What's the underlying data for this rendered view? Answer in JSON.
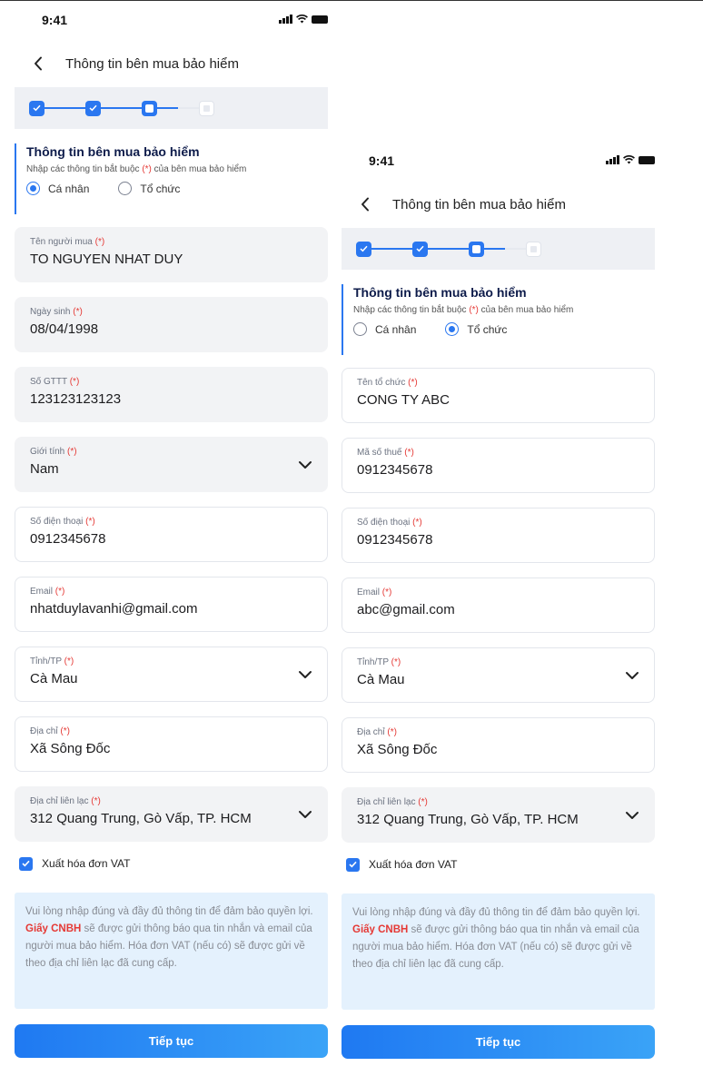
{
  "status_bar": {
    "time": "9:41"
  },
  "header": {
    "title": "Thông tin bên mua bảo hiểm"
  },
  "section": {
    "title": "Thông tin bên mua bảo hiểm",
    "subtitle_pre": "Nhập các thông tin bắt buộc ",
    "subtitle_req": "(*)",
    "subtitle_post": " của bên mua bảo hiểm"
  },
  "radio_options": {
    "individual": "Cá nhân",
    "organization": "Tổ chức"
  },
  "required_marker": "(*)",
  "left": {
    "selected_type": "Cá nhân",
    "fields": [
      {
        "label": "Tên người mua",
        "value": "TO NGUYEN NHAT DUY"
      },
      {
        "label": "Ngày sinh",
        "value": "08/04/1998"
      },
      {
        "label": "Số GTTT",
        "value": "123123123123"
      },
      {
        "label": "Giới tính",
        "value": "Nam"
      },
      {
        "label": "Số điện thoại",
        "value": "0912345678"
      },
      {
        "label": "Email",
        "value": "nhatduylavanhi@gmail.com"
      },
      {
        "label": "Tỉnh/TP",
        "value": "Cà Mau"
      },
      {
        "label": "Địa chỉ",
        "value": "Xã Sông Đốc"
      },
      {
        "label": "Địa chỉ liên lạc",
        "value": "312 Quang Trung, Gò Vấp, TP. HCM"
      }
    ]
  },
  "right": {
    "selected_type": "Tổ chức",
    "fields": [
      {
        "label": "Tên tổ chức",
        "value": "CONG TY ABC"
      },
      {
        "label": "Mã số thuế",
        "value": "0912345678"
      },
      {
        "label": "Số điện thoại",
        "value": "0912345678"
      },
      {
        "label": "Email",
        "value": "abc@gmail.com"
      },
      {
        "label": "Tỉnh/TP",
        "value": "Cà Mau"
      },
      {
        "label": "Địa chỉ",
        "value": "Xã Sông Đốc"
      },
      {
        "label": "Địa chỉ liên lạc",
        "value": "312 Quang Trung, Gò Vấp, TP. HCM"
      }
    ]
  },
  "vat": {
    "label": "Xuất hóa đơn VAT",
    "checked": true
  },
  "notice": {
    "pre": "Vui lòng nhập đúng và đầy đủ thông tin để đảm bảo quyền lợi. ",
    "highlight": "Giấy CNBH",
    "post": " sẽ được gửi thông báo qua tin nhắn và email của người mua bảo hiểm. Hóa đơn VAT (nếu có) sẽ được gửi về theo địa chỉ liên lạc đã cung cấp."
  },
  "cta": {
    "label": "Tiếp tục"
  },
  "colors": {
    "primary": "#2a77f0",
    "required": "#e53935",
    "notice_bg": "#e4f1fd"
  },
  "icons": {
    "back": "chevron-left-icon",
    "dropdown": "chevron-down-icon",
    "check": "check-icon"
  }
}
